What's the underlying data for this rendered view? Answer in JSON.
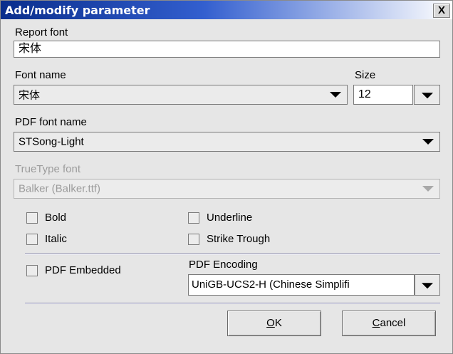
{
  "dialog": {
    "title": "Add/modify parameter",
    "close_label": "X"
  },
  "report_font": {
    "label": "Report font",
    "value": "宋体"
  },
  "font_name": {
    "label": "Font name",
    "value": "宋体"
  },
  "size": {
    "label": "Size",
    "value": "12"
  },
  "pdf_font_name": {
    "label": "PDF font name",
    "value": "STSong-Light"
  },
  "truetype_font": {
    "label": "TrueType font",
    "value": "Balker (Balker.ttf)",
    "enabled": false
  },
  "checkboxes": {
    "bold": {
      "label": "Bold",
      "checked": false
    },
    "italic": {
      "label": "Italic",
      "checked": false
    },
    "underline": {
      "label": "Underline",
      "checked": false
    },
    "strike": {
      "label": "Strike Trough",
      "checked": false
    },
    "pdf_embedded": {
      "label": "PDF Embedded",
      "checked": false
    }
  },
  "pdf_encoding": {
    "label": "PDF Encoding",
    "value": "UniGB-UCS2-H (Chinese Simplifi"
  },
  "buttons": {
    "ok_mnemonic": "O",
    "ok_rest": "K",
    "cancel_mnemonic": "C",
    "cancel_rest": "ancel"
  },
  "colors": {
    "title_bar_start": "#0a2e8c",
    "title_bar_end": "#ffffff",
    "dialog_background": "#e6e6e6",
    "disabled_text": "#9c9c9c"
  },
  "icons": [
    "close-icon",
    "chevron-down-icon"
  ]
}
